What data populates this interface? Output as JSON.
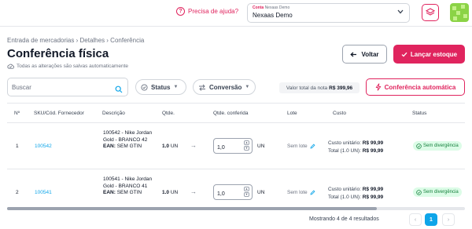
{
  "colors": {
    "accent": "#e0245e",
    "link": "#0ea5e9",
    "success": "#15803d"
  },
  "topbar": {
    "help_label": "Precisa de ajuda?",
    "account_label_prefix": "Conta",
    "account_label_name": "Nexaas Demo",
    "account_value": "Nexaas Demo"
  },
  "header": {
    "breadcrumb": "Entrada de mercadorias › Detalhes › Conferência",
    "title": "Conferência física",
    "autosave": "Todas as alterações são salvas automaticamente",
    "back_label": "Voltar",
    "launch_label": "Lançar estoque"
  },
  "filters": {
    "search_placeholder": "Buscar",
    "status_label": "Status",
    "conversion_label": "Conversão",
    "total_label": "Valor total da nota",
    "total_value": "R$ 399,96",
    "auto_label": "Conferência automática"
  },
  "table": {
    "headers": [
      "Nº",
      "SKU/Cód. Fornecedor",
      "Descrição",
      "Qtde.",
      "Qtde. conferida",
      "Lote",
      "Custo",
      "Status"
    ],
    "rows": [
      {
        "n": "1",
        "sku": "100542",
        "desc": "100542 - Nike Jordan Gold - BRANCO 42",
        "ean_label": "EAN:",
        "ean_value": "SEM GTIN",
        "qty_value": "1.0",
        "qty_unit": "UN",
        "checked": "1,0",
        "checked_unit": "UN",
        "lote": "Sem lote",
        "unit_cost_label": "Custo unitário:",
        "unit_cost": "R$ 99,99",
        "total_cost_label": "Total (1.0 UN):",
        "total_cost": "R$ 99,99",
        "status": "Sem divergência"
      },
      {
        "n": "2",
        "sku": "100541",
        "desc": "100541 - Nike Jordan Gold - BRANCO 41",
        "ean_label": "EAN:",
        "ean_value": "SEM GTIN",
        "qty_value": "1.0",
        "qty_unit": "UN",
        "checked": "1,0",
        "checked_unit": "UN",
        "lote": "Sem lote",
        "unit_cost_label": "Custo unitário:",
        "unit_cost": "R$ 99,99",
        "total_cost_label": "Total (1.0 UN):",
        "total_cost": "R$ 99,99",
        "status": "Sem divergência"
      }
    ]
  },
  "pagination": {
    "results": "Mostrando 4 de 4 resultados",
    "prev": "‹",
    "current": "1",
    "next": "›"
  }
}
